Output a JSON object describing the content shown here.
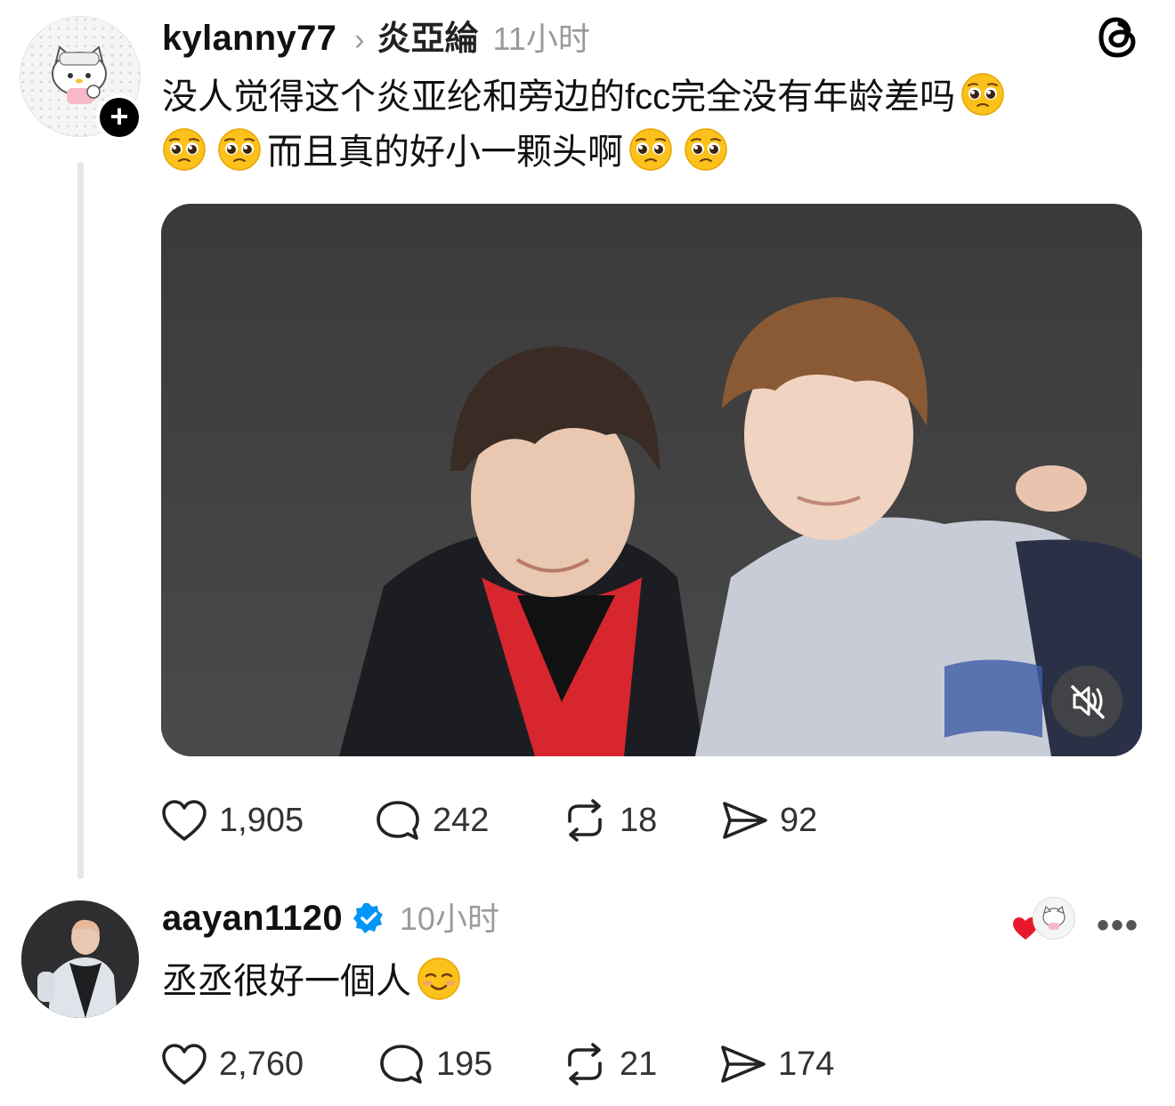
{
  "post1": {
    "username": "kylanny77",
    "chevron": "›",
    "tag": "炎亞綸",
    "time": "11小时",
    "text_line1": "没人觉得这个炎亚纶和旁边的fcc完全没有年龄差吗",
    "text_line2": "而且真的好小一颗头啊",
    "emoji": "pleading-face",
    "follow_button": "+",
    "media": {
      "type": "video",
      "muted": true
    },
    "actions": {
      "likes": "1,905",
      "replies": "242",
      "reposts": "18",
      "shares": "92"
    }
  },
  "post2": {
    "username": "aayan1120",
    "verified": true,
    "time": "10小时",
    "text": "丞丞很好一個人",
    "emoji": "smiling-face",
    "more_label": "•••",
    "actions": {
      "likes": "2,760",
      "replies": "195",
      "reposts": "21",
      "shares": "174"
    }
  },
  "icons": {
    "logo": "threads-logo",
    "like": "heart-icon",
    "reply": "comment-icon",
    "repost": "repost-icon",
    "share": "send-icon",
    "mute": "muted-speaker-icon"
  },
  "colors": {
    "text": "#111111",
    "muted": "#9a9a9a",
    "verified": "#0095f6",
    "like_red": "#e8192c"
  }
}
